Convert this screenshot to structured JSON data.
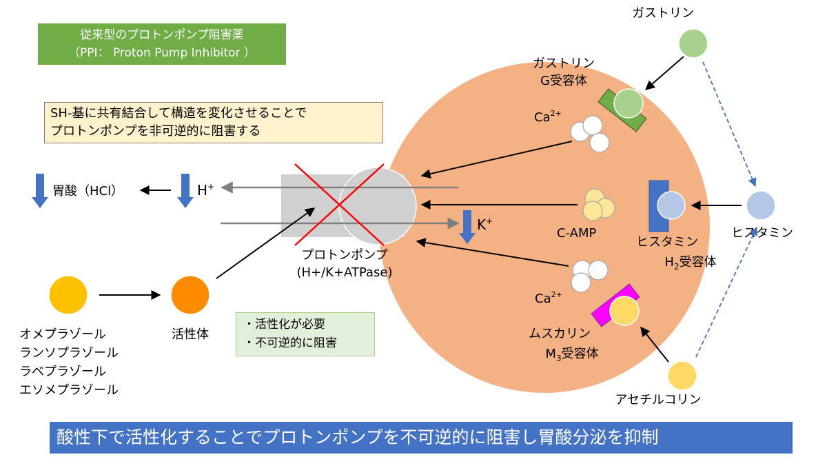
{
  "title": {
    "line1": "従来型のプロトンポンプ阻害薬",
    "line2": "（PPI： Proton Pump Inhibitor ）"
  },
  "mechanism": {
    "line1": "SH-基に共有結合して構造を変化させることで",
    "line2": "プロトンポンプを非可逆的に阻害する"
  },
  "acid": {
    "stomach_acid": "胃酸（HCl）",
    "h_plus": "H",
    "k_plus": "K"
  },
  "pump": {
    "label_line1": "プロトンポンプ",
    "label_line2": "(H+/K+ATPase)"
  },
  "drugs": {
    "prodrug_names": [
      "オメプラゾール",
      "ランソプラゾール",
      "ラベプラゾール",
      "エソメプラゾール"
    ],
    "active_form": "活性体"
  },
  "notes": [
    "・活性化が必要",
    "・不可逆的に阻害"
  ],
  "messengers": {
    "ca_top": "Ca",
    "ca_bottom": "Ca",
    "ca_superscript": "2+",
    "camp": "C-AMP"
  },
  "receptors": {
    "gastrin_receptor_line1": "ガストリン",
    "gastrin_receptor_line2": "G受容体",
    "histamine_receptor_line1": "ヒスタミン",
    "histamine_receptor_h": "H",
    "histamine_receptor_sub": "2",
    "histamine_receptor_rest": "受容体",
    "muscarinic_receptor_line1": "ムスカリン",
    "muscarinic_receptor_m": "M",
    "muscarinic_receptor_sub": "3",
    "muscarinic_receptor_rest": "受容体"
  },
  "ligands": {
    "gastrin": "ガストリン",
    "histamine": "ヒスタミン",
    "acetylcholine": "アセチルコリン"
  },
  "summary": "酸性下で活性化することでプロトンポンプを不可逆的に阻害し胃酸分泌を抑制",
  "colors": {
    "cell": "#f4b183",
    "title_bg": "#70ad47",
    "mech_bg": "#fff2cc",
    "note_bg": "#e2efda",
    "summary_bg": "#4472c4",
    "prodrug": "#ffc000",
    "active": "#ff8c00",
    "gastrin": "#a9d18e",
    "histamine": "#b4c7e7",
    "acetylcholine": "#ffd966",
    "g_receptor": "#70ad47",
    "h2_receptor": "#4472c4",
    "m3_receptor": "#ff00ff",
    "block_x": "#ff0000"
  }
}
